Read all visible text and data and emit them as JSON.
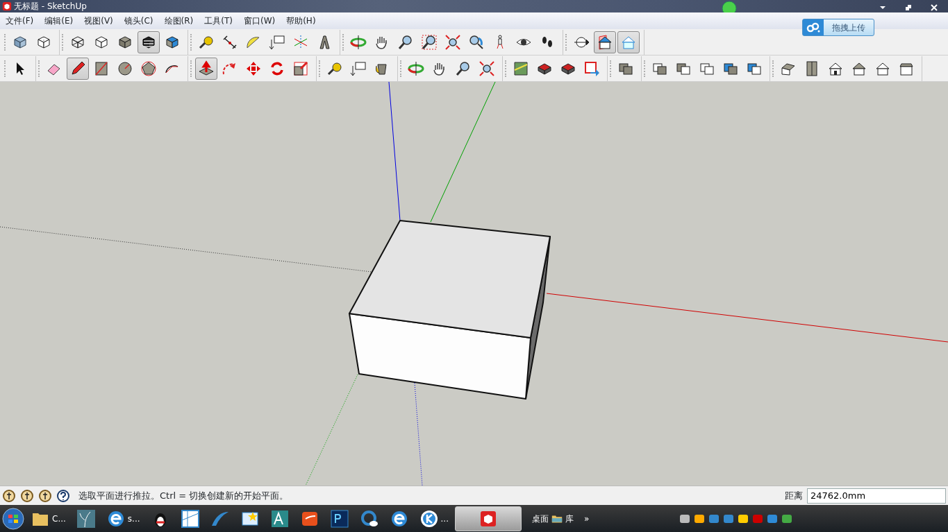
{
  "window": {
    "title": "无标题 - SketchUp"
  },
  "menu": [
    "文件(F)",
    "编辑(E)",
    "视图(V)",
    "镜头(C)",
    "绘图(R)",
    "工具(T)",
    "窗口(W)",
    "帮助(H)"
  ],
  "upload_button": {
    "label": "拖拽上传"
  },
  "toolbar_rows": [
    [
      [
        {
          "kind": "xray",
          "pressed": false
        },
        {
          "kind": "backedges",
          "pressed": false
        }
      ],
      [
        {
          "kind": "wireframe",
          "pressed": false
        },
        {
          "kind": "hiddenline",
          "pressed": false
        },
        {
          "kind": "shaded",
          "pressed": false
        },
        {
          "kind": "textured",
          "pressed": true
        },
        {
          "kind": "monochrome",
          "pressed": false
        }
      ],
      [
        {
          "kind": "tape",
          "pressed": false
        },
        {
          "kind": "dimension",
          "pressed": false
        },
        {
          "kind": "protractor",
          "pressed": false
        },
        {
          "kind": "text",
          "pressed": false
        },
        {
          "kind": "axes",
          "pressed": false
        },
        {
          "kind": "text3d",
          "pressed": false
        }
      ],
      [
        {
          "kind": "orbit",
          "pressed": false
        },
        {
          "kind": "pan",
          "pressed": false
        },
        {
          "kind": "zoom",
          "pressed": false
        },
        {
          "kind": "zoomwindow",
          "pressed": false
        },
        {
          "kind": "zoomextents",
          "pressed": false
        },
        {
          "kind": "previous",
          "pressed": false
        },
        {
          "kind": "walk",
          "pressed": false
        },
        {
          "kind": "eye",
          "pressed": false
        },
        {
          "kind": "footprints",
          "pressed": false
        }
      ],
      [
        {
          "kind": "sectionplane",
          "pressed": false
        },
        {
          "kind": "sectioncut",
          "pressed": true
        },
        {
          "kind": "sectionfill",
          "pressed": true
        }
      ]
    ],
    [
      [
        {
          "kind": "select",
          "pressed": false
        }
      ],
      [
        {
          "kind": "eraser",
          "pressed": false
        },
        {
          "kind": "pencil",
          "pressed": true
        },
        {
          "kind": "rectangle",
          "pressed": false
        },
        {
          "kind": "circle",
          "pressed": false
        },
        {
          "kind": "polygon",
          "pressed": false
        },
        {
          "kind": "arc",
          "pressed": false
        }
      ],
      [
        {
          "kind": "pushpull",
          "pressed": true
        },
        {
          "kind": "followme",
          "pressed": false
        },
        {
          "kind": "move",
          "pressed": false
        },
        {
          "kind": "rotate",
          "pressed": false
        },
        {
          "kind": "scale",
          "pressed": false
        }
      ],
      [
        {
          "kind": "tape",
          "pressed": false
        },
        {
          "kind": "text",
          "pressed": false
        },
        {
          "kind": "paint",
          "pressed": false
        }
      ],
      [
        {
          "kind": "orbit",
          "pressed": false
        },
        {
          "kind": "pan",
          "pressed": false
        },
        {
          "kind": "zoom",
          "pressed": false
        },
        {
          "kind": "zoomextents",
          "pressed": false
        }
      ],
      [
        {
          "kind": "map",
          "pressed": false
        },
        {
          "kind": "component",
          "pressed": false
        },
        {
          "kind": "component",
          "pressed": false
        },
        {
          "kind": "export",
          "pressed": false
        }
      ],
      [
        {
          "kind": "solid",
          "pressed": false
        }
      ],
      [
        {
          "kind": "solidouter",
          "pressed": false
        },
        {
          "kind": "solidsplit",
          "pressed": false
        },
        {
          "kind": "solidsub",
          "pressed": false
        },
        {
          "kind": "solidblue",
          "pressed": false
        },
        {
          "kind": "solidblue2",
          "pressed": false
        }
      ],
      [
        {
          "kind": "houseiso",
          "pressed": false
        },
        {
          "kind": "housetop",
          "pressed": false
        },
        {
          "kind": "housefront",
          "pressed": false
        },
        {
          "kind": "houseright",
          "pressed": false
        },
        {
          "kind": "houseback",
          "pressed": false
        },
        {
          "kind": "houseleft",
          "pressed": false
        }
      ]
    ]
  ],
  "status_bar": {
    "hint": "选取平面进行推拉。Ctrl = 切换创建新的开始平面。",
    "measure_label": "距离",
    "measure_value": "24762.0mm"
  },
  "taskbar": {
    "items": [
      {
        "kind": "folder",
        "label": "C...",
        "selected": false
      },
      {
        "kind": "plant",
        "selected": false
      },
      {
        "kind": "ie",
        "label": "s...",
        "selected": false
      },
      {
        "kind": "penguin",
        "selected": false
      },
      {
        "kind": "map",
        "selected": false
      },
      {
        "kind": "swoosh",
        "selected": false
      },
      {
        "kind": "star",
        "selected": false
      },
      {
        "kind": "cad",
        "selected": false
      },
      {
        "kind": "orange",
        "selected": false
      },
      {
        "kind": "ps",
        "selected": false
      },
      {
        "kind": "qcloud",
        "selected": false
      },
      {
        "kind": "ie",
        "selected": false
      },
      {
        "kind": "k",
        "label": "...",
        "selected": false
      },
      {
        "kind": "sketchup",
        "selected": true
      }
    ],
    "toolbar_labels": [
      "桌面",
      "库",
      "»"
    ]
  }
}
